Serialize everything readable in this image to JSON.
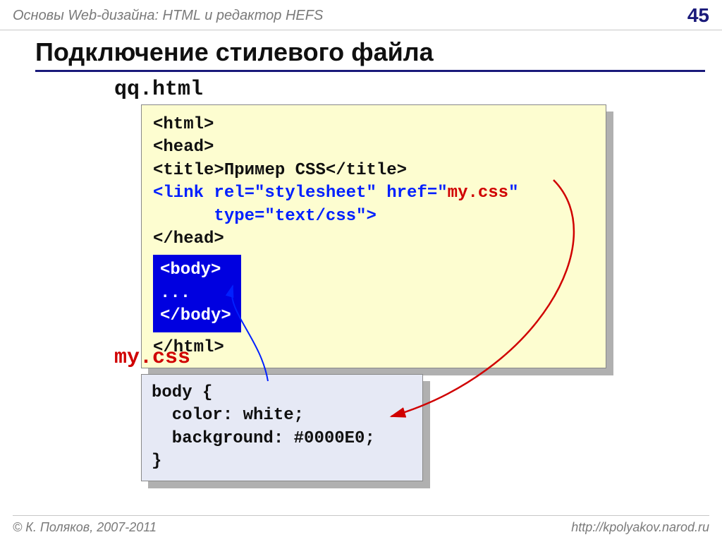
{
  "header": {
    "subject": "Основы Web-дизайна: HTML и редактор HEFS",
    "slideNumber": "45"
  },
  "title": "Подключение стилевого файла",
  "file1": {
    "name": "qq.html"
  },
  "code1": {
    "l1": "<html>",
    "l2": "<head>",
    "l3a": "<title>",
    "l3b": "Пример CSS",
    "l3c": "</title>",
    "l4a": "<link rel=\"stylesheet\" href=\"",
    "l4b": "my.css",
    "l4c": "\"",
    "l5": "      type=\"text/css\">",
    "l6": "</head>",
    "body1": "<body>",
    "body2": "...",
    "body3": "</body>",
    "l7": "</html>"
  },
  "file2": {
    "name": "my.css"
  },
  "code2": {
    "l1": "body {",
    "l2": "  color: white;",
    "l3": "  background: #0000E0;",
    "l4": "}"
  },
  "footer": {
    "copyright": "© К. Поляков, 2007-2011",
    "url": "http://kpolyakov.narod.ru"
  }
}
